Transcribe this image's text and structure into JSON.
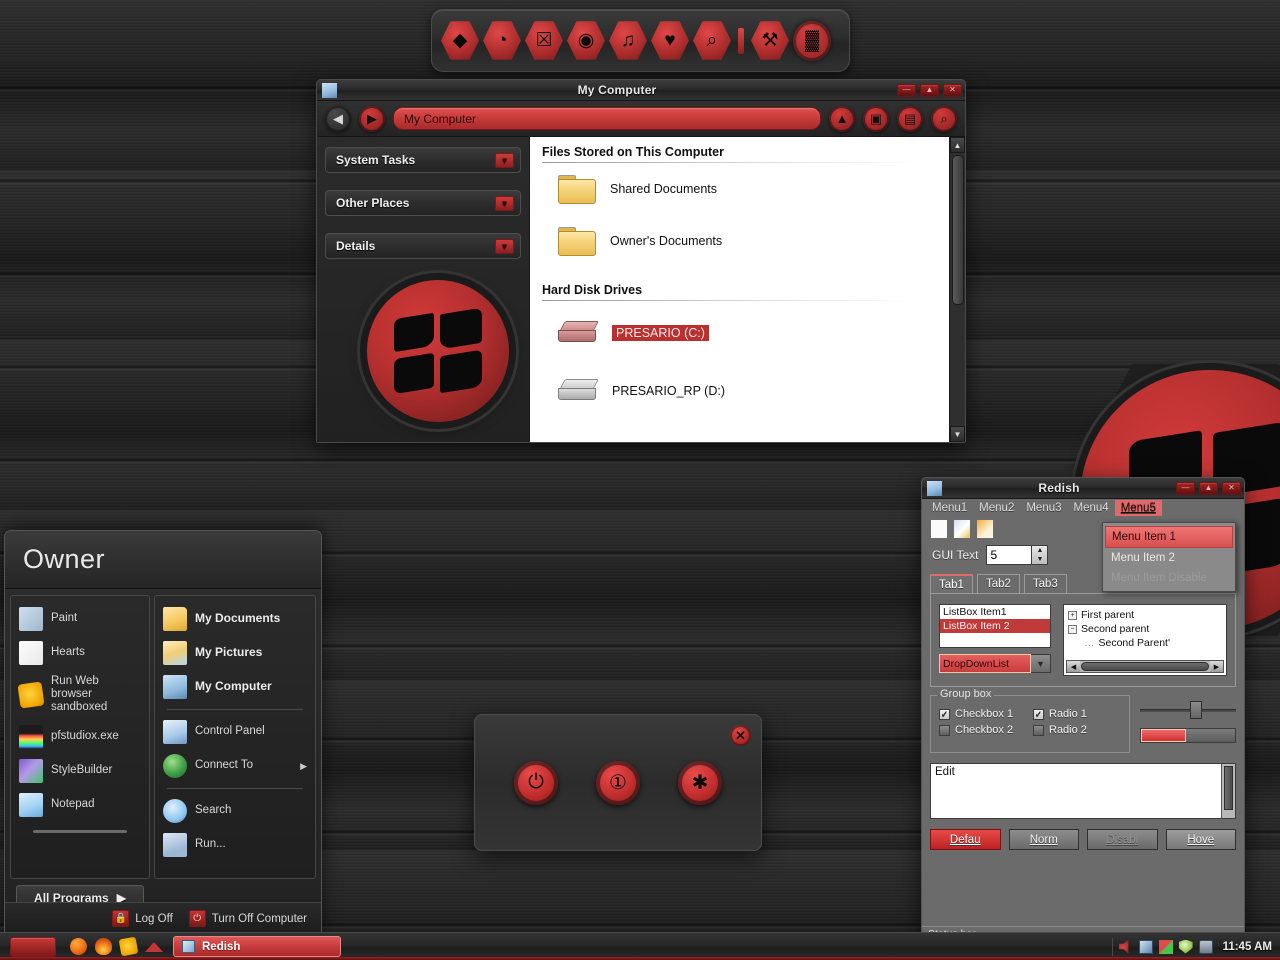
{
  "desktop": {
    "watermark_logo": "windows-flag-logo",
    "accent_red": "#c63a3a",
    "bg_dark": "#262626"
  },
  "dock": {
    "items": [
      {
        "name": "whale-icon",
        "glyph": "◆"
      },
      {
        "name": "firefox-icon",
        "glyph": "◔"
      },
      {
        "name": "image-viewer-icon",
        "glyph": "☒"
      },
      {
        "name": "media-player-icon",
        "glyph": "◉"
      },
      {
        "name": "music-icon",
        "glyph": "♫"
      },
      {
        "name": "heart-icon",
        "glyph": "♥"
      },
      {
        "name": "search-icon",
        "glyph": "⌕"
      },
      {
        "name": "separator-icon",
        "glyph": ""
      },
      {
        "name": "tools-icon",
        "glyph": "⚒"
      },
      {
        "name": "trash-icon",
        "glyph": "▓"
      }
    ]
  },
  "my_computer_window": {
    "title": "My Computer",
    "titlebar_buttons": [
      {
        "name": "minimize-button",
        "glyph": "—"
      },
      {
        "name": "maximize-button",
        "glyph": "▲"
      },
      {
        "name": "close-button",
        "glyph": "✕"
      }
    ],
    "toolbar": {
      "back_glyph": "◀",
      "forward_glyph": "▶",
      "address_value": "My Computer",
      "up_glyph": "▲",
      "search_glyph": "▣",
      "folders_glyph": "▤",
      "views_glyph": "⌕"
    },
    "sidebar_panels": [
      {
        "label": "System Tasks",
        "chevron": "▼"
      },
      {
        "label": "Other Places",
        "chevron": "▼"
      },
      {
        "label": "Details",
        "chevron": "▼"
      }
    ],
    "sections": [
      {
        "heading": "Files Stored on This Computer",
        "items": [
          {
            "label": "Shared Documents",
            "icon": "folder-icon",
            "selected": false
          },
          {
            "label": "Owner's Documents",
            "icon": "folder-icon",
            "selected": false
          }
        ]
      },
      {
        "heading": "Hard Disk Drives",
        "items": [
          {
            "label": "PRESARIO (C:)",
            "icon": "hard-drive-icon",
            "selected": true
          },
          {
            "label": "PRESARIO_RP (D:)",
            "icon": "hard-drive-icon",
            "selected": false
          }
        ]
      }
    ]
  },
  "redish_window": {
    "title": "Redish",
    "titlebar_buttons": [
      {
        "name": "minimize-button",
        "glyph": "—"
      },
      {
        "name": "maximize-button",
        "glyph": "▲"
      },
      {
        "name": "close-button",
        "glyph": "✕"
      }
    ],
    "menubar": [
      {
        "label": "Menu1",
        "active": false
      },
      {
        "label": "Menu2",
        "active": false
      },
      {
        "label": "Menu3",
        "active": false
      },
      {
        "label": "Menu4",
        "active": false
      },
      {
        "label": "Menu5",
        "active": true
      }
    ],
    "dropdown_menu": [
      {
        "label": "Menu Item 1",
        "state": "highlighted"
      },
      {
        "label": "Menu Item 2",
        "state": "normal"
      },
      {
        "label": "Menu Item Disable",
        "state": "disabled"
      }
    ],
    "toolbar_icons": [
      "new-document-icon",
      "edit-document-icon",
      "open-folder-icon"
    ],
    "gui_text_label": "GUI Text",
    "gui_text_value": "5",
    "spinner_up": "▲",
    "spinner_down": "▼",
    "tabs": [
      {
        "label": "Tab1",
        "active": true
      },
      {
        "label": "Tab2",
        "active": false
      },
      {
        "label": "Tab3",
        "active": false
      }
    ],
    "listbox": [
      {
        "label": "ListBox Item1",
        "selected": false
      },
      {
        "label": "ListBox Item 2",
        "selected": true
      }
    ],
    "dropdownlist_value": "DropDownList",
    "dropdownlist_arrow": "▼",
    "tree": [
      {
        "label": "First parent",
        "expander": "+",
        "indent": 0
      },
      {
        "label": "Second parent",
        "expander": "−",
        "indent": 0
      },
      {
        "label": "Second Parent'",
        "expander": "",
        "indent": 1
      }
    ],
    "tree_scroll_left": "◀",
    "tree_scroll_right": "▶",
    "groupbox": {
      "title": "Group box",
      "options": [
        {
          "label": "Checkbox 1",
          "type": "checkbox",
          "checked": true
        },
        {
          "label": "Radio 1",
          "type": "radio",
          "checked": true
        },
        {
          "label": "Checkbox 2",
          "type": "checkbox",
          "checked": false
        },
        {
          "label": "Radio 2",
          "type": "radio",
          "checked": false
        }
      ]
    },
    "edit_value": "Edit",
    "buttons": [
      {
        "label": "Defau",
        "state": "default"
      },
      {
        "label": "Norm",
        "state": "normal"
      },
      {
        "label": "Disabl",
        "state": "disabled"
      },
      {
        "label": "Hove",
        "state": "hover"
      }
    ],
    "statusbar": "Status bar"
  },
  "start_menu": {
    "user_name": "Owner",
    "left_items": [
      {
        "label": "Paint",
        "icon": "paint-icon"
      },
      {
        "label": "Hearts",
        "icon": "hearts-icon"
      },
      {
        "label": "Run Web browser sandboxed",
        "icon": "sandbox-icon"
      },
      {
        "label": "pfstudiox.exe",
        "icon": "studio-icon"
      },
      {
        "label": "StyleBuilder",
        "icon": "stylebuilder-icon"
      },
      {
        "label": "Notepad",
        "icon": "notepad-icon"
      }
    ],
    "right_items": [
      {
        "label": "My Documents",
        "icon": "my-documents-icon",
        "bold": true,
        "arrow": false
      },
      {
        "label": "My Pictures",
        "icon": "my-pictures-icon",
        "bold": true,
        "arrow": false
      },
      {
        "label": "My Computer",
        "icon": "my-computer-icon",
        "bold": true,
        "arrow": false
      },
      {
        "label": "Control Panel",
        "icon": "control-panel-icon",
        "bold": false,
        "arrow": false
      },
      {
        "label": "Connect To",
        "icon": "connect-to-icon",
        "bold": false,
        "arrow": true
      },
      {
        "label": "Search",
        "icon": "search-icon",
        "bold": false,
        "arrow": false
      },
      {
        "label": "Run...",
        "icon": "run-icon",
        "bold": false,
        "arrow": false
      }
    ],
    "all_programs_label": "All Programs",
    "all_programs_arrow": "▶",
    "log_off_label": "Log Off",
    "log_off_icon": "lock-icon",
    "turn_off_label": "Turn Off Computer",
    "turn_off_icon": "power-icon"
  },
  "shutdown_dialog": {
    "buttons": [
      {
        "name": "stand-by-button",
        "glyph": "⏻"
      },
      {
        "name": "turn-off-button",
        "glyph": "①"
      },
      {
        "name": "restart-button",
        "glyph": "✱"
      }
    ],
    "close_glyph": "✕"
  },
  "taskbar": {
    "start_button": "start-button",
    "quick_launch": [
      "firefox-icon",
      "flame-icon",
      "sandbox-icon",
      "triangle-icon"
    ],
    "task_buttons": [
      {
        "label": "Redish",
        "active": true
      }
    ],
    "tray_icons": [
      "volume-icon",
      "network-icon",
      "windows-update-icon",
      "security-shield-icon",
      "display-icon"
    ],
    "clock": "11:45 AM"
  }
}
